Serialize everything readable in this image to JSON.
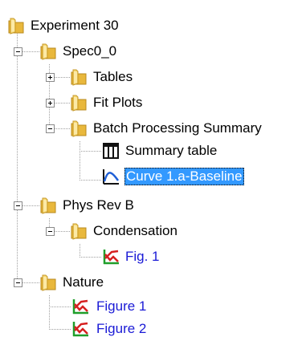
{
  "tree": {
    "root": {
      "label": "Experiment 30",
      "icon": "folder-icon"
    },
    "spec": {
      "label": "Spec0_0",
      "icon": "folder-icon",
      "expanded": true
    },
    "tables": {
      "label": "Tables",
      "icon": "folder-icon",
      "expanded": false
    },
    "fit_plots": {
      "label": "Fit Plots",
      "icon": "folder-icon",
      "expanded": false
    },
    "batch_summary": {
      "label": "Batch Processing Summary",
      "icon": "folder-icon",
      "expanded": true
    },
    "summary_table": {
      "label": "Summary table",
      "icon": "table-icon"
    },
    "curve_baseline": {
      "label": "Curve 1.a-Baseline",
      "icon": "curve-icon",
      "selected": true
    },
    "phys_rev": {
      "label": "Phys Rev B",
      "icon": "folder-icon",
      "expanded": true
    },
    "condensation": {
      "label": "Condensation",
      "icon": "folder-icon",
      "expanded": true
    },
    "fig1": {
      "label": "Fig. 1",
      "icon": "graph-icon"
    },
    "nature": {
      "label": "Nature",
      "icon": "folder-icon",
      "expanded": true
    },
    "figure1": {
      "label": "Figure 1",
      "icon": "graph-icon"
    },
    "figure2": {
      "label": "Figure 2",
      "icon": "graph-icon"
    }
  },
  "colors": {
    "selection": "#3399ff",
    "link": "#1a1ad6",
    "folder": "#f2c94c",
    "graph_red": "#d62020",
    "graph_green": "#1f9e2a"
  }
}
